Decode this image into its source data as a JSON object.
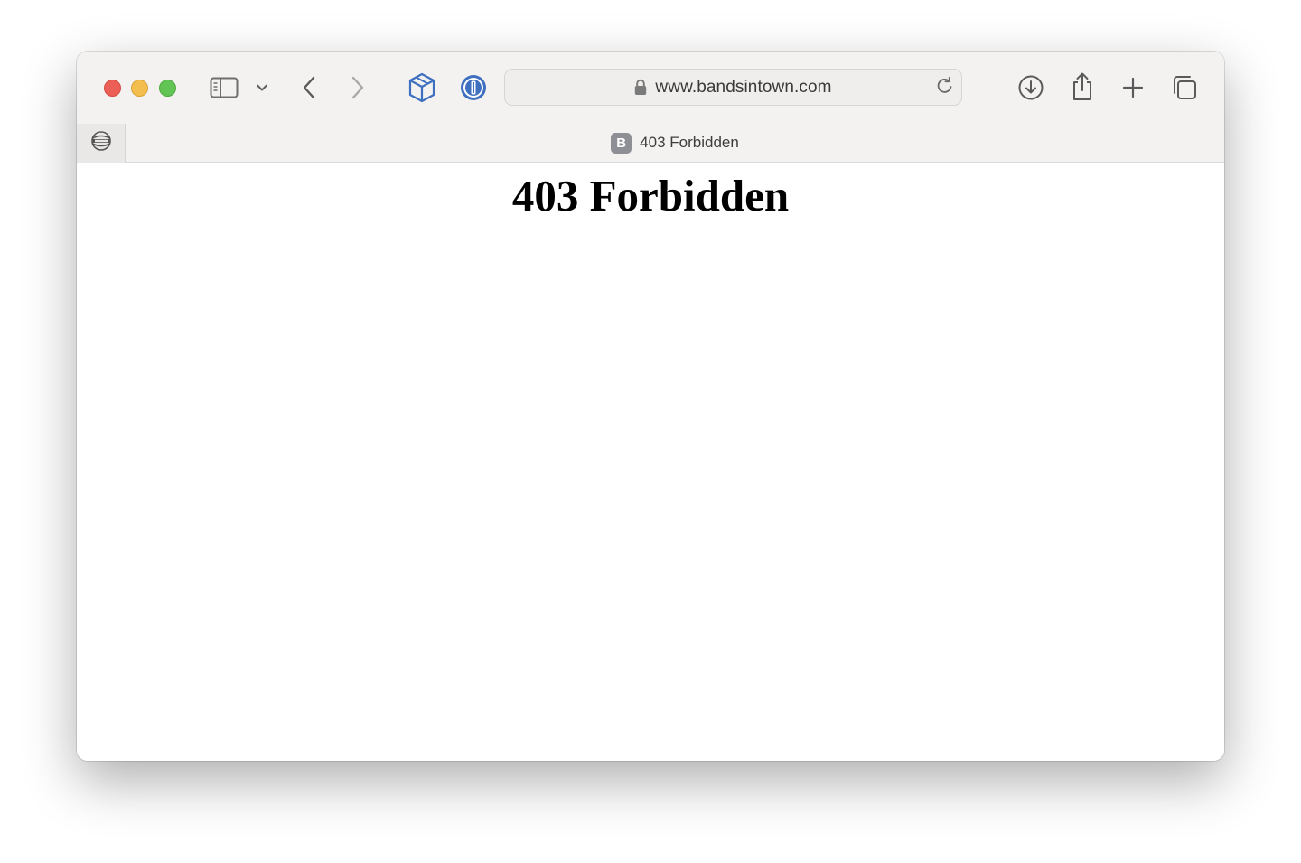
{
  "window": {
    "traffic_lights": [
      "close",
      "minimize",
      "maximize"
    ]
  },
  "toolbar": {
    "icons": {
      "sidebar": "sidebar-icon",
      "tab_group_menu": "chevron-down-icon",
      "back": "chevron-left-icon",
      "forward": "chevron-right-icon",
      "extension_1": "cube-icon",
      "extension_2": "1password-icon",
      "download": "download-icon",
      "share": "share-icon",
      "new_tab": "plus-icon",
      "tab_overview": "tab-overview-icon"
    },
    "address_bar": {
      "url": "www.bandsintown.com",
      "secure": true
    }
  },
  "tabs": {
    "pinned": [
      {
        "icon": "pinned-site-icon"
      }
    ],
    "active": {
      "favicon_letter": "B",
      "title": "403 Forbidden"
    }
  },
  "page": {
    "heading": "403 Forbidden"
  },
  "colors": {
    "close": "#ec5f57",
    "minimize": "#f4be4f",
    "maximize": "#61c454",
    "extension_blue": "#3f6fbf",
    "favicon_bg": "#8e8e95"
  }
}
